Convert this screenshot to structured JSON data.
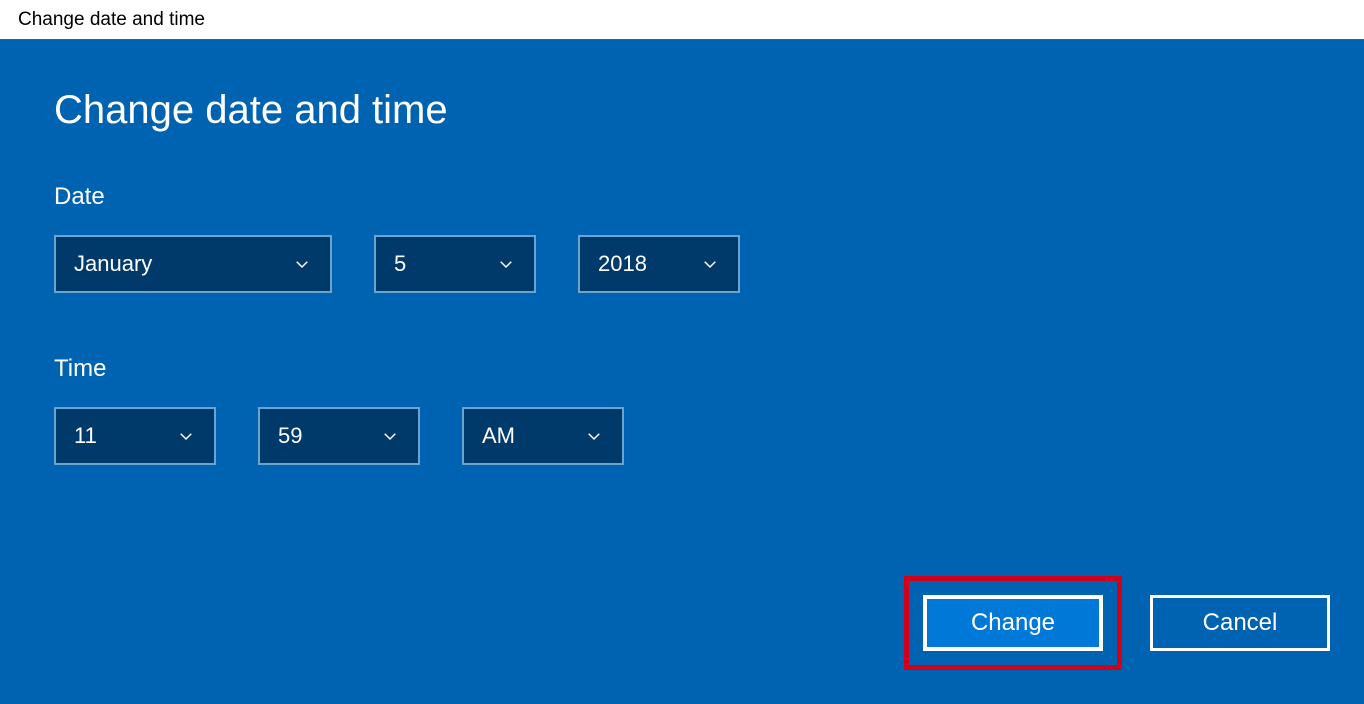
{
  "window": {
    "title": "Change date and time"
  },
  "heading": "Change date and time",
  "sections": {
    "date_label": "Date",
    "time_label": "Time"
  },
  "date": {
    "month": "January",
    "day": "5",
    "year": "2018"
  },
  "time": {
    "hour": "11",
    "minute": "59",
    "ampm": "AM"
  },
  "buttons": {
    "change": "Change",
    "cancel": "Cancel"
  }
}
